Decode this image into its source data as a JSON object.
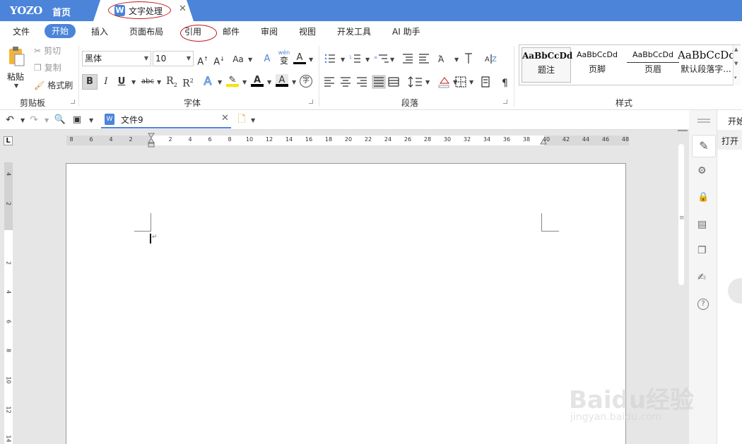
{
  "titlebar": {
    "logo": "YOZO",
    "home_tab": "首页",
    "doc_tab": "文字处理",
    "doc_tab_icon": "W",
    "close_glyph": "✕"
  },
  "menu": {
    "items": [
      "文件",
      "开始",
      "插入",
      "页面布局",
      "引用",
      "邮件",
      "审阅",
      "视图",
      "开发工具",
      "AI 助手"
    ],
    "active": "开始"
  },
  "ribbon": {
    "clipboard": {
      "paste": "粘贴",
      "cut": "剪切",
      "copy": "复制",
      "format_painter": "格式刷",
      "group_label": "剪贴板"
    },
    "font": {
      "font_name": "黑体",
      "font_size": "10",
      "group_label": "字体",
      "bold": "B",
      "italic": "I",
      "underline": "U",
      "strike": "abc",
      "subscript": "R",
      "superscript": "R",
      "grow": "A",
      "shrink": "A",
      "case": "Aa",
      "phonetic": "wén",
      "phonetic_char": "变",
      "enclose": "字"
    },
    "paragraph": {
      "group_label": "段落"
    },
    "styles": {
      "group_label": "样式",
      "cards": [
        {
          "sample": "AaBbCcDd",
          "name": "题注"
        },
        {
          "sample": "AaBbCcDd",
          "name": "页脚"
        },
        {
          "sample": "AaBbCcDd",
          "name": "页眉"
        },
        {
          "sample": "AaBbCcDd",
          "name": "默认段落字..."
        }
      ]
    }
  },
  "quickbar": {
    "doc_name": "文件9"
  },
  "ruler": {
    "h_numbers": [
      "8",
      "6",
      "4",
      "2",
      "2",
      "4",
      "6",
      "8",
      "10",
      "12",
      "14",
      "16",
      "18",
      "20",
      "22",
      "24",
      "26",
      "28",
      "30",
      "32",
      "34",
      "36",
      "38",
      "40",
      "42",
      "44",
      "46",
      "48"
    ],
    "v_numbers": [
      "4",
      "2",
      "2",
      "4",
      "6",
      "8",
      "10",
      "12",
      "14"
    ],
    "corner": "L"
  },
  "side_panel": {
    "tab_label": "开始",
    "open_label": "打开"
  },
  "watermark": {
    "brand": "Baidu经验",
    "url": "jingyan.baidu.com"
  },
  "colors": {
    "accent": "#4b84d9",
    "annotation": "#c0161b"
  }
}
